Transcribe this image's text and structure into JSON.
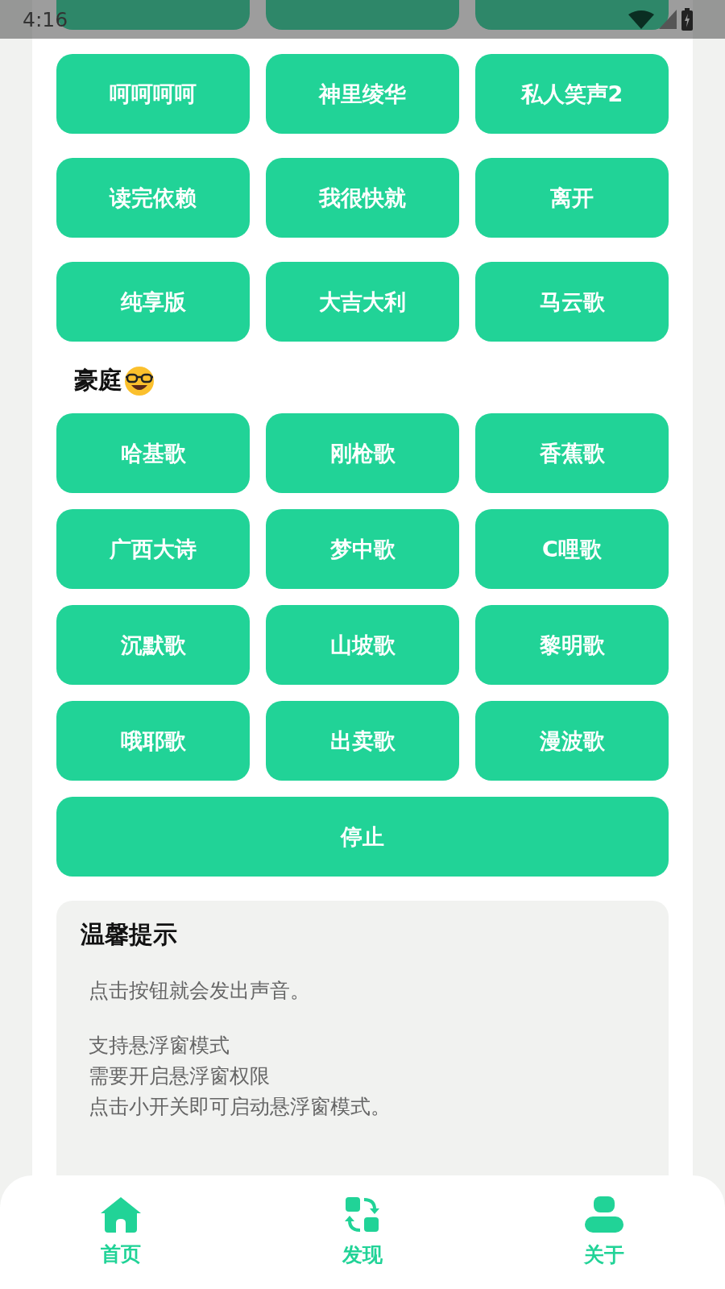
{
  "status_bar": {
    "time": "4:16"
  },
  "sections": [
    {
      "buttons": [
        "呵呵呵呵",
        "神里绫华",
        "私人笑声2",
        "读完依赖",
        "我很快就",
        "离开",
        "纯享版",
        "大吉大利",
        "马云歌"
      ]
    },
    {
      "heading": "豪庭",
      "buttons": [
        "哈基歌",
        "刚枪歌",
        "香蕉歌",
        "广西大诗",
        "梦中歌",
        "C哩歌",
        "沉默歌",
        "山坡歌",
        "黎明歌",
        "哦耶歌",
        "出卖歌",
        "漫波歌"
      ]
    }
  ],
  "stop_button": "停止",
  "tip_card": {
    "title": "温馨提示",
    "paragraphs": [
      [
        "点击按钮就会发出声音。"
      ],
      [
        "支持悬浮窗模式",
        "需要开启悬浮窗权限",
        "点击小开关即可启动悬浮窗模式。"
      ]
    ]
  },
  "nav": [
    {
      "kind": "home",
      "label": "首页"
    },
    {
      "kind": "discover",
      "label": "发现"
    },
    {
      "kind": "about",
      "label": "关于"
    }
  ]
}
